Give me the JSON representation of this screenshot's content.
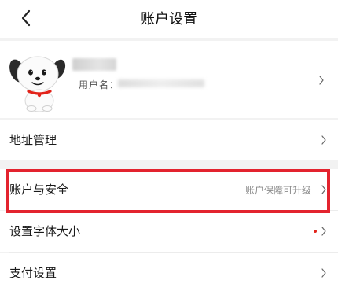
{
  "header": {
    "title": "账户设置",
    "back_icon": "chevron-left-icon"
  },
  "profile": {
    "username_label": "用户名：",
    "avatar_icon": "jd-dog-mascot-avatar",
    "chevron_icon": "chevron-right-icon"
  },
  "menu": {
    "address": {
      "label": "地址管理"
    },
    "account_security": {
      "label": "账户与安全",
      "hint": "账户保障可升级"
    },
    "font_size": {
      "label": "设置字体大小",
      "has_red_dot": true
    },
    "payment": {
      "label": "支付设置"
    }
  },
  "colors": {
    "highlight_border": "#e3232e",
    "red_dot": "#e2231a",
    "page_background": "#f2f2f2",
    "card_background": "#ffffff"
  }
}
